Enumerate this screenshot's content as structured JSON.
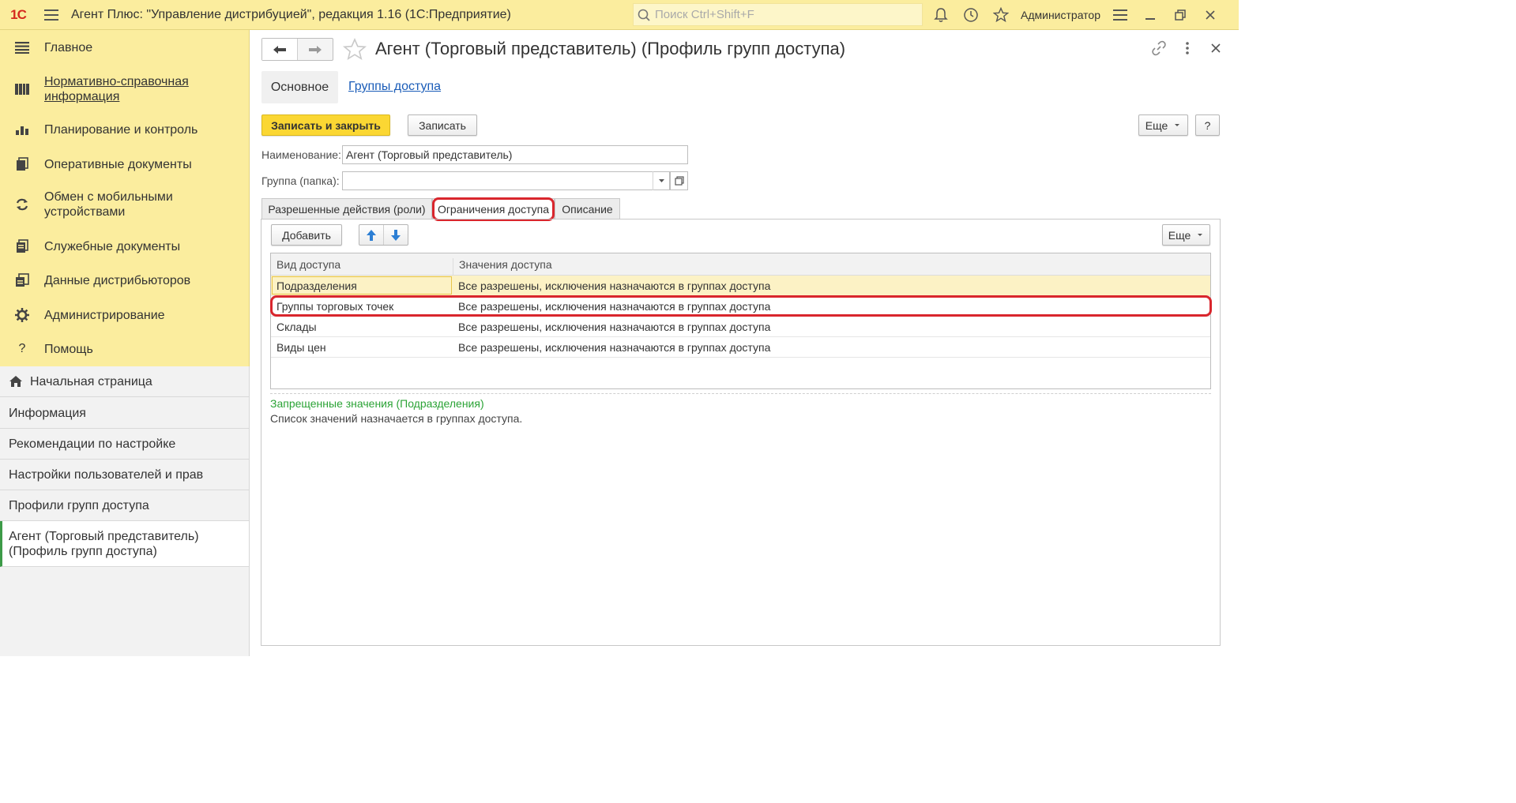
{
  "topbar": {
    "logo": "1С",
    "title": "Агент Плюс: \"Управление дистрибуцией\", редакция 1.16  (1С:Предприятие)",
    "search_placeholder": "Поиск Ctrl+Shift+F",
    "user": "Администратор"
  },
  "sections": [
    {
      "label": "Главное",
      "icon": "hamburger-icon"
    },
    {
      "label": "Нормативно-справочная информация",
      "icon": "catalog-icon"
    },
    {
      "label": "Планирование и контроль",
      "icon": "chart-icon"
    },
    {
      "label": "Оперативные документы",
      "icon": "documents-icon"
    },
    {
      "label": "Обмен с мобильными устройствами",
      "icon": "sync-icon"
    },
    {
      "label": "Служебные документы",
      "icon": "service-docs-icon"
    },
    {
      "label": "Данные дистрибьюторов",
      "icon": "distributor-data-icon"
    },
    {
      "label": "Администрирование",
      "icon": "gear-icon"
    },
    {
      "label": "Помощь",
      "icon": "help-icon"
    }
  ],
  "nav": [
    {
      "label": "Начальная страница",
      "icon": "home-icon"
    },
    {
      "label": "Информация"
    },
    {
      "label": "Рекомендации по настройке"
    },
    {
      "label": "Настройки пользователей и прав"
    },
    {
      "label": "Профили групп доступа"
    },
    {
      "label": "Агент (Торговый представитель) (Профиль групп доступа)"
    }
  ],
  "form": {
    "title": "Агент (Торговый представитель) (Профиль групп доступа)",
    "tab_main": "Основное",
    "tab_groups": "Группы доступа",
    "save_close": "Записать и закрыть",
    "save": "Записать",
    "more": "Еще",
    "help": "?",
    "name_label": "Наименование:",
    "name_value": "Агент (Торговый представитель)",
    "group_label": "Группа (папка):",
    "group_value": "",
    "tabs": [
      "Разрешенные действия (роли)",
      "Ограничения доступа",
      "Описание"
    ],
    "add": "Добавить",
    "more2": "Еще",
    "grid": {
      "headers": [
        "Вид доступа",
        "Значения доступа"
      ],
      "rows": [
        {
          "kind": "Подразделения",
          "value": "Все разрешены, исключения назначаются в группах доступа"
        },
        {
          "kind": "Группы торговых точек",
          "value": "Все разрешены, исключения назначаются в группах доступа"
        },
        {
          "kind": "Склады",
          "value": "Все разрешены, исключения назначаются в группах доступа"
        },
        {
          "kind": "Виды цен",
          "value": "Все разрешены, исключения назначаются в группах доступа"
        }
      ]
    },
    "hint_title": "Запрещенные значения (Подразделения)",
    "hint_text": "Список значений назначается в группах доступа."
  },
  "colors": {
    "accent_yellow": "#fbed9e",
    "primary_button": "#fbd733",
    "highlight_red": "#d9262d",
    "hint_green": "#2ba336"
  }
}
